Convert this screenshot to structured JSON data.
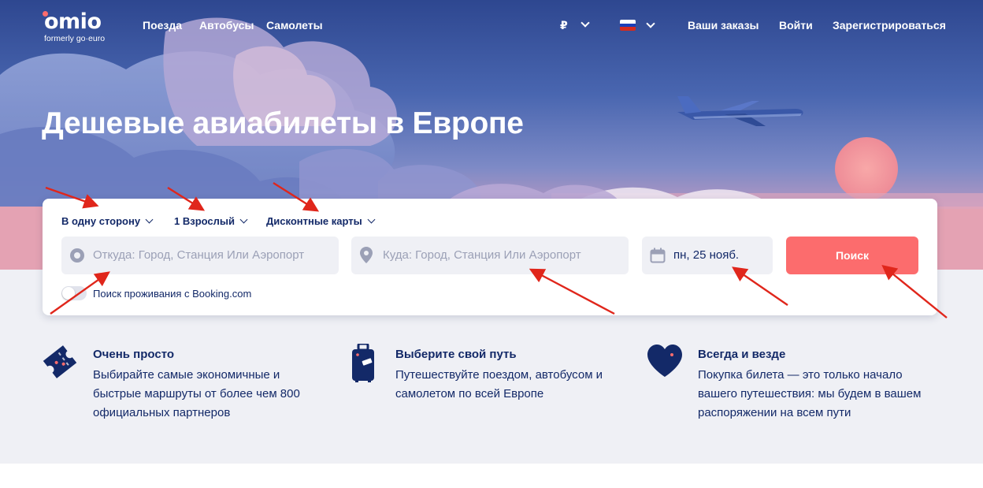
{
  "header": {
    "logo": "omio",
    "logo_sub": "formerly go·euro",
    "nav": [
      "Поезда",
      "Автобусы",
      "Самолеты"
    ],
    "currency": "₽",
    "orders": "Ваши заказы",
    "login": "Войти",
    "register": "Зарегистрироваться"
  },
  "hero": {
    "title": "Дешевые авиабилеты в Европе"
  },
  "search": {
    "trip_type": "В одну сторону",
    "passengers": "1 Взрослый",
    "discount_cards": "Дисконтные карты",
    "from_placeholder": "Откуда: Город, Станция Или Аэропорт",
    "to_placeholder": "Куда: Город, Станция Или Аэропорт",
    "date": "пн, 25 нояб.",
    "button": "Поиск",
    "booking_label": "Поиск проживания с Booking.com",
    "booking_enabled": false
  },
  "features": [
    {
      "icon": "ticket-icon",
      "title": "Очень просто",
      "lines": [
        "Выбирайте самые экономичные и",
        "быстрые маршруты от более чем 800",
        "официальных партнеров"
      ]
    },
    {
      "icon": "suitcase-icon",
      "title": "Выберите свой путь",
      "lines": [
        "Путешествуйте поездом, автобусом и",
        "самолетом по всей Европе"
      ]
    },
    {
      "icon": "heart-icon",
      "title": "Всегда и везде",
      "lines": [
        "Покупка билета — это только начало",
        "вашего путешествия: мы будем в вашем",
        "распоряжении на всем пути"
      ]
    }
  ],
  "colors": {
    "brand_navy": "#132968",
    "accent_coral": "#fc6c6d",
    "field_bg": "#eff0f5",
    "annotation_red": "#e0261b"
  }
}
